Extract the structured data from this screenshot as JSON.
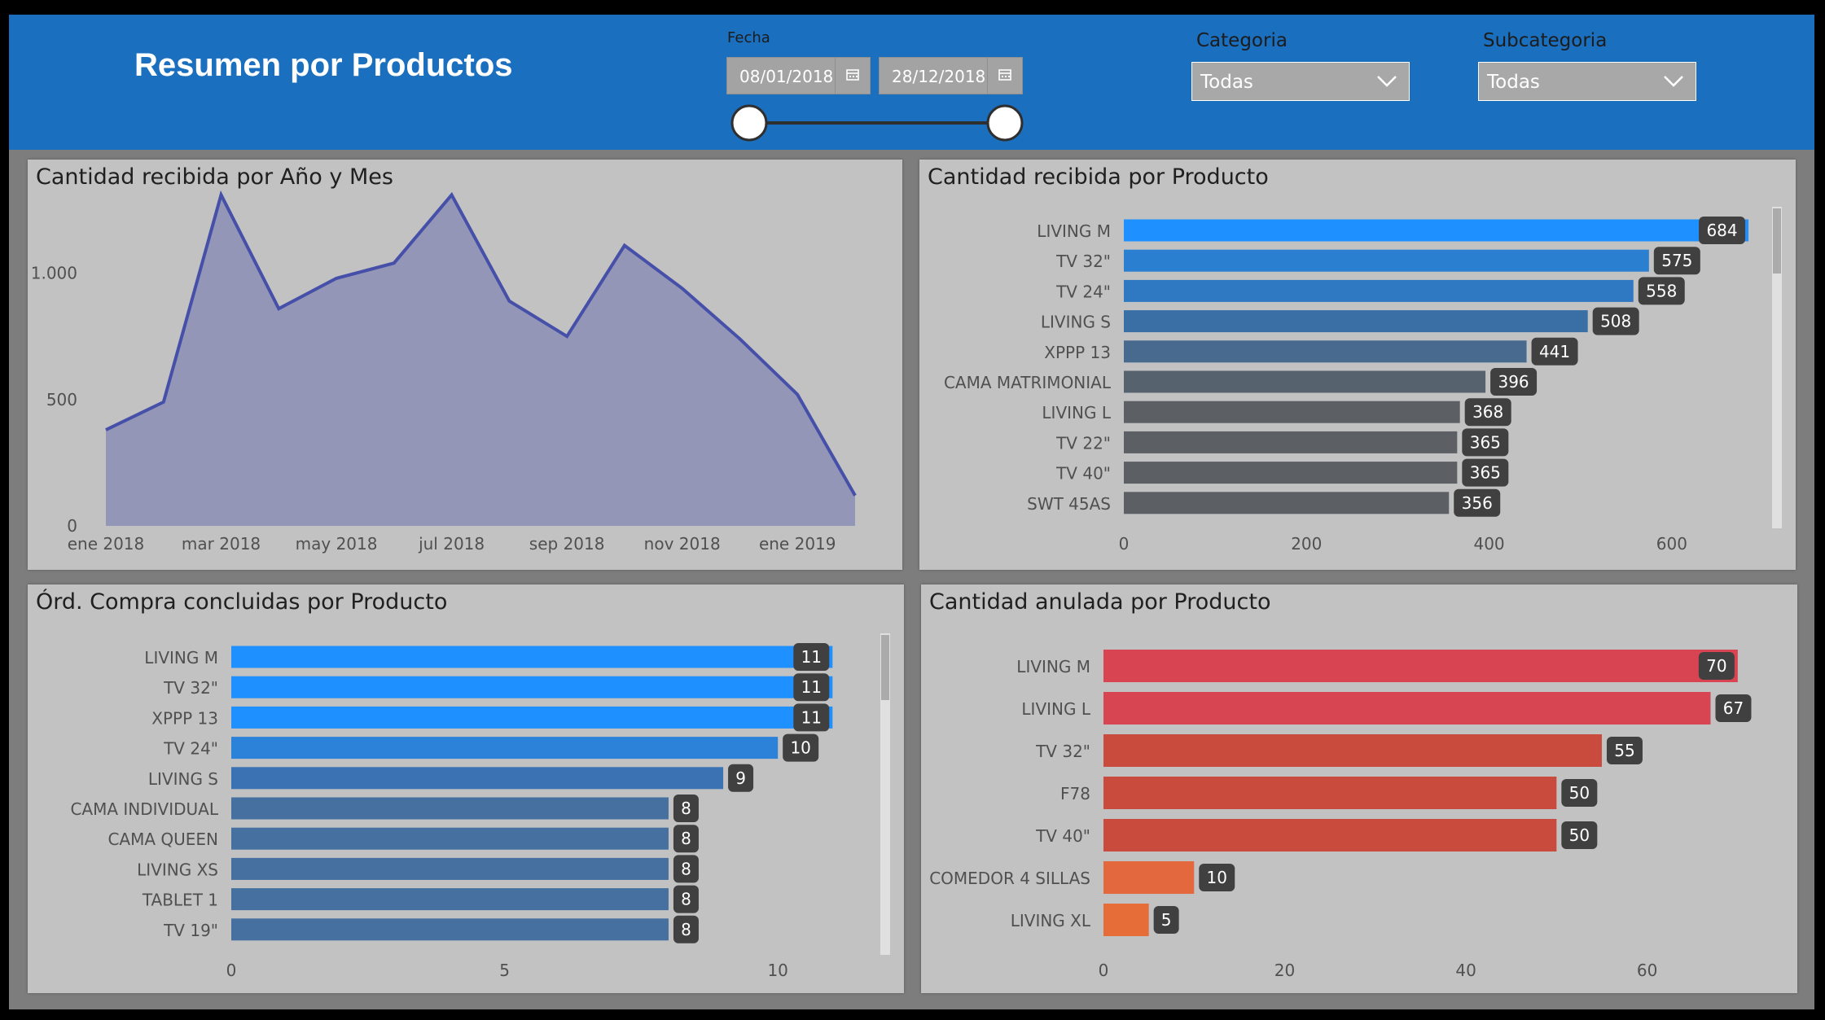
{
  "header": {
    "title": "Resumen por Productos",
    "date_label": "Fecha",
    "date_start": "08/01/2018",
    "date_end": "28/12/2018",
    "category_label": "Categoria",
    "category_value": "Todas",
    "subcategory_label": "Subcategoria",
    "subcategory_value": "Todas"
  },
  "colors": {
    "header_bg": "#1a6fbf",
    "panel_bg": "#c2c2c2",
    "area_fill": "#9496b7",
    "area_line": "#4650a9",
    "label_bg": "#404040",
    "bar_blue": "#1e90ff",
    "bar_slate": "#5f6770",
    "bar_red": "#d44352",
    "bar_orange": "#e3683d"
  },
  "charts": {
    "monthly": {
      "title": "Cantidad recibida por Año y Mes",
      "chart_data": {
        "type": "area",
        "x": [
          "ene 2018",
          "feb 2018",
          "mar 2018",
          "abr 2018",
          "may 2018",
          "jun 2018",
          "jul 2018",
          "ago 2018",
          "sep 2018",
          "oct 2018",
          "nov 2018",
          "dic 2018",
          "ene 2019",
          "feb 2019"
        ],
        "values": [
          380,
          490,
          1310,
          860,
          980,
          1040,
          1310,
          890,
          750,
          1110,
          940,
          740,
          520,
          120
        ],
        "xticks": [
          "ene 2018",
          "mar 2018",
          "may 2018",
          "jul 2018",
          "sep 2018",
          "nov 2018",
          "ene 2019"
        ],
        "yticks": [
          "0",
          "500",
          "1.000"
        ],
        "ylim": [
          0,
          1450
        ]
      }
    },
    "received": {
      "title": "Cantidad recibida por Producto",
      "chart_data": {
        "type": "bar",
        "categories": [
          "LIVING M",
          "TV 32\"",
          "TV 24\"",
          "LIVING S",
          "XPPP 13",
          "CAMA MATRIMONIAL",
          "LIVING L",
          "TV 22\"",
          "TV 40\"",
          "SWT 45AS"
        ],
        "values": [
          684,
          575,
          558,
          508,
          441,
          396,
          368,
          365,
          365,
          356
        ],
        "colors": [
          "#1e90ff",
          "#2b7fd0",
          "#2f79c3",
          "#3a6fa6",
          "#486a8e",
          "#57626f",
          "#5c5f64",
          "#5c5f64",
          "#5c5f64",
          "#5c5f64"
        ],
        "xticks": [
          "0",
          "200",
          "400",
          "600"
        ],
        "xlim": [
          0,
          700
        ]
      }
    },
    "orders": {
      "title": "Órd. Compra concluidas por Producto",
      "chart_data": {
        "type": "bar",
        "categories": [
          "LIVING M",
          "TV 32\"",
          "XPPP 13",
          "TV 24\"",
          "LIVING S",
          "CAMA INDIVIDUAL",
          "CAMA QUEEN",
          "LIVING XS",
          "TABLET 1",
          "TV 19\""
        ],
        "values": [
          11,
          11,
          11,
          10,
          9,
          8,
          8,
          8,
          8,
          8
        ],
        "colors": [
          "#1e90ff",
          "#1e90ff",
          "#1e90ff",
          "#2c82d8",
          "#3a72b3",
          "#4570a0",
          "#4570a0",
          "#4570a0",
          "#4570a0",
          "#4570a0"
        ],
        "xticks": [
          "0",
          "5",
          "10"
        ],
        "xlim": [
          0,
          11.8
        ]
      }
    },
    "cancelled": {
      "title": "Cantidad anulada por Producto",
      "chart_data": {
        "type": "bar",
        "categories": [
          "LIVING M",
          "LIVING L",
          "TV 32\"",
          "F78",
          "TV 40\"",
          "COMEDOR 4 SILLAS",
          "LIVING XL"
        ],
        "values": [
          70,
          67,
          55,
          50,
          50,
          10,
          5
        ],
        "colors": [
          "#d94452",
          "#d74452",
          "#c84b3e",
          "#c84b3e",
          "#c84b3e",
          "#e3683d",
          "#e66c38"
        ],
        "xticks": [
          "0",
          "20",
          "40",
          "60"
        ],
        "xlim": [
          0,
          71
        ]
      }
    }
  }
}
